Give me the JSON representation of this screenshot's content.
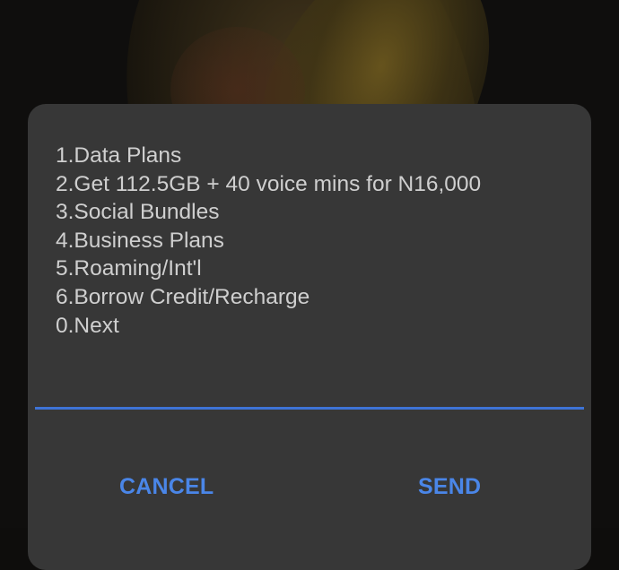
{
  "ussd_dialog": {
    "menu_lines": [
      "1.Data Plans",
      "2.Get 112.5GB + 40 voice mins for N16,000",
      "3.Social Bundles",
      "4.Business Plans",
      "5.Roaming/Int'l",
      "6.Borrow Credit/Recharge",
      "0.Next"
    ],
    "input_value": "",
    "cancel_label": "CANCEL",
    "send_label": "SEND"
  },
  "colors": {
    "dialog_background": "#373737",
    "text": "#cfcfcf",
    "accent": "#4a86e8",
    "input_underline": "#3e73d6"
  }
}
